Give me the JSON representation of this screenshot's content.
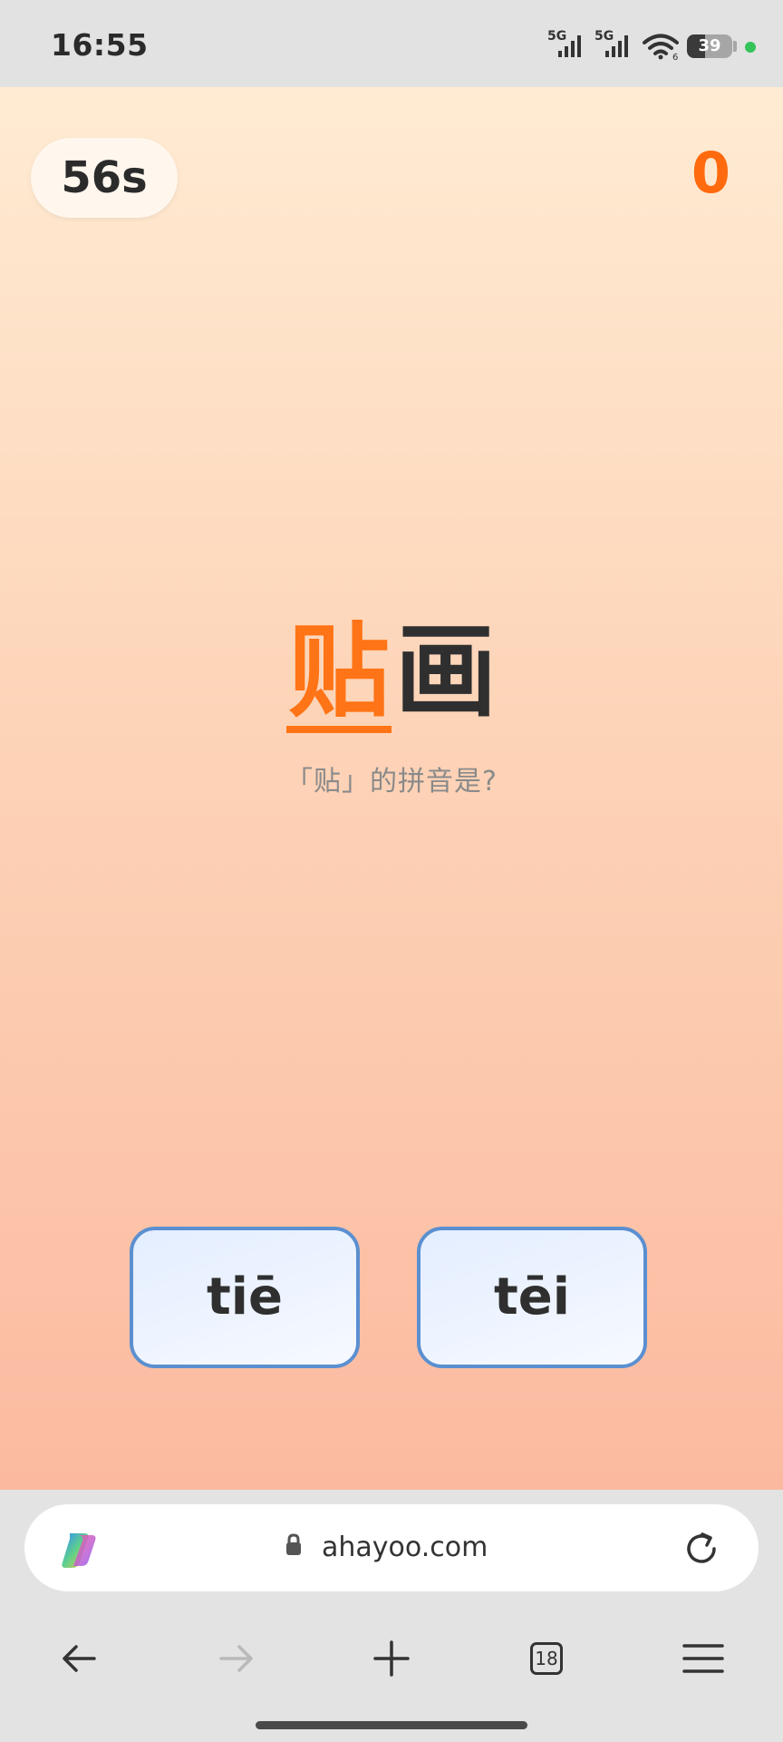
{
  "status_bar": {
    "time": "16:55",
    "signal_1_label": "5G",
    "signal_2_label": "5G",
    "wifi_icon": "wifi-icon",
    "battery_level": "39",
    "battery_fraction": 0.39,
    "dot_color": "#35c35a"
  },
  "game": {
    "timer": "56s",
    "score": "0",
    "word_highlight": "贴",
    "word_rest": "画",
    "question": "「贴」的拼音是?",
    "options": [
      {
        "label": "tiē"
      },
      {
        "label": "tēi"
      }
    ],
    "accent_color": "#ff7416",
    "option_border_color": "#5b8fd0"
  },
  "browser": {
    "assistant_icon": "copilot-icon",
    "lock_icon": "lock-icon",
    "url": "ahayoo.com",
    "reload_icon": "reload-icon"
  },
  "nav": {
    "back_icon": "arrow-left-icon",
    "forward_icon": "arrow-right-icon",
    "new_tab_icon": "plus-icon",
    "tab_count": "18",
    "menu_icon": "hamburger-menu-icon"
  }
}
